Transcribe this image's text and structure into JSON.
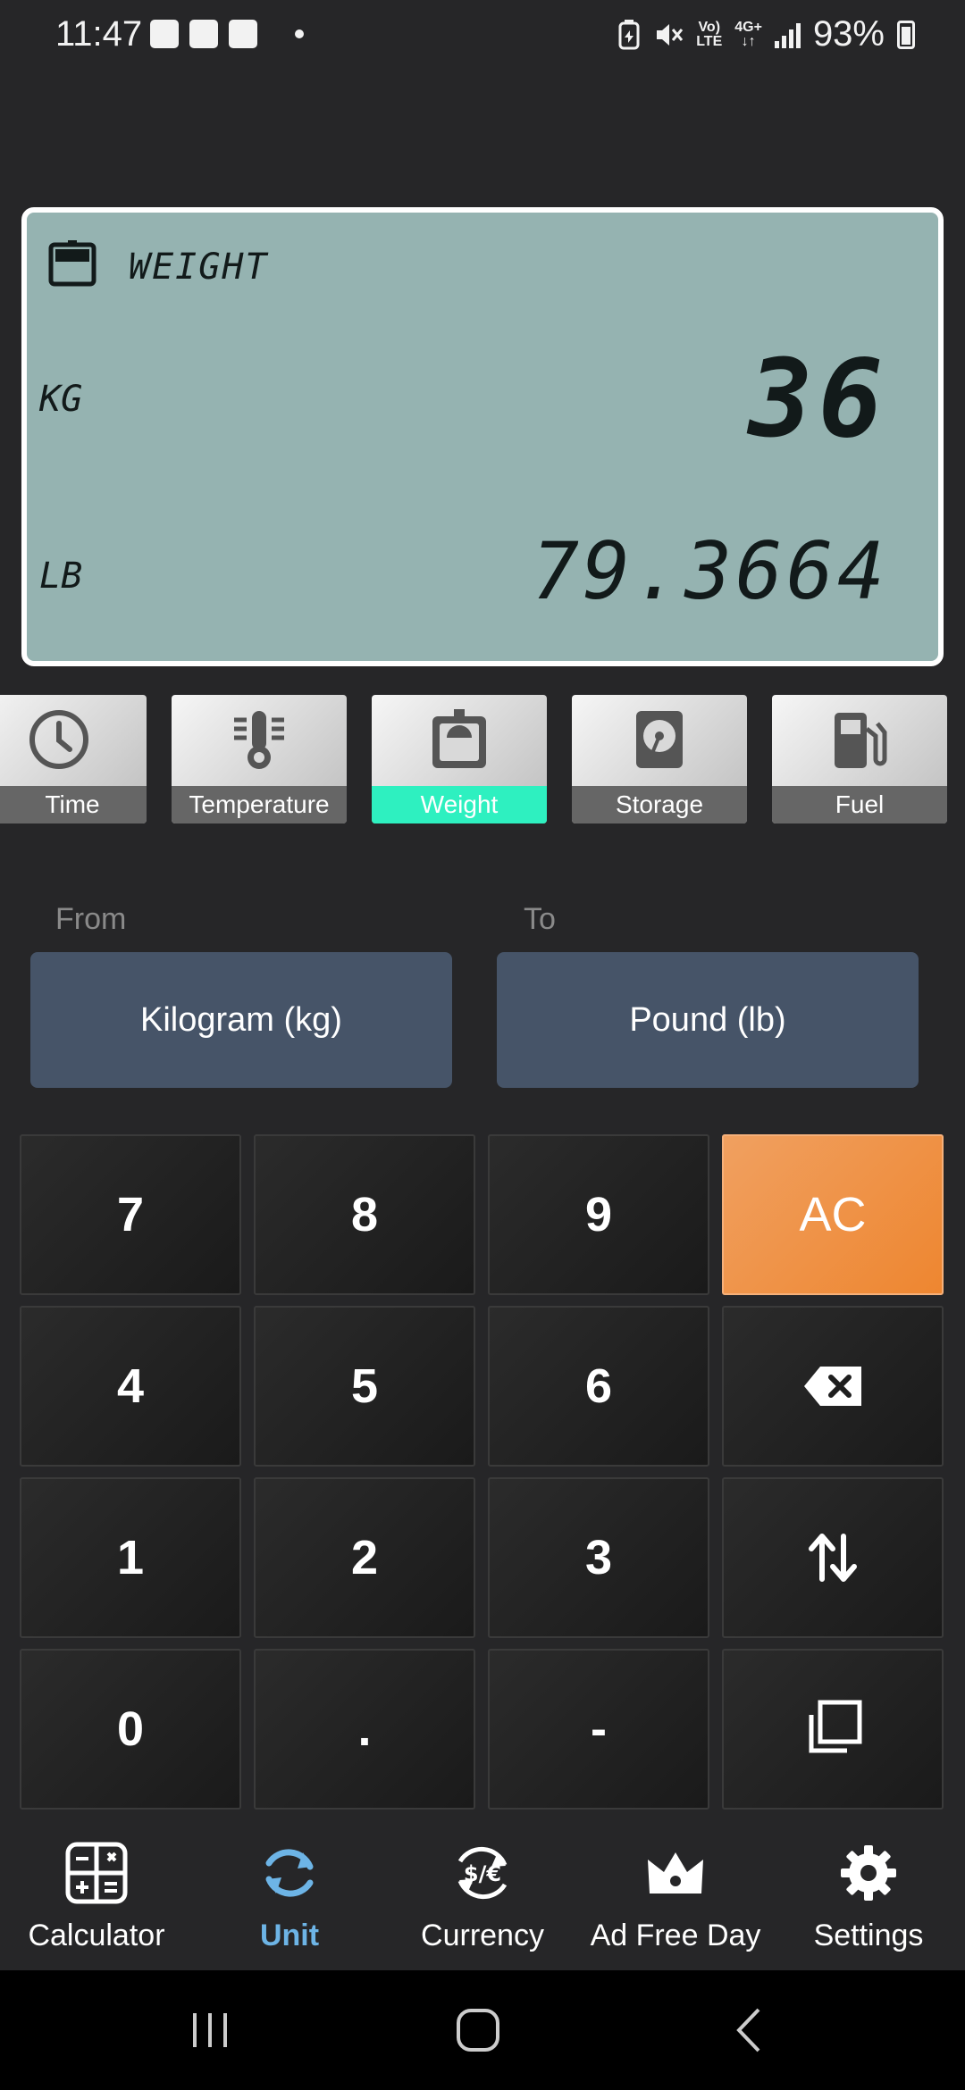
{
  "status_bar": {
    "time": "11:47",
    "battery": "93%",
    "network_top": "Vo)",
    "network_bottom": "LTE",
    "signal_type": "4G+",
    "signal_arrows": "↓↑"
  },
  "display": {
    "category_title": "WEIGHT",
    "category_icon": "weight-scale-icon",
    "input_unit": "KG",
    "input_value": "36",
    "output_unit": "LB",
    "output_value": "79.3664",
    "background_color": "#95b3b1"
  },
  "categories": [
    {
      "label": "Time",
      "icon": "clock-icon"
    },
    {
      "label": "Temperature",
      "icon": "thermometer-icon"
    },
    {
      "label": "Weight",
      "icon": "weight-scale-icon",
      "active": true
    },
    {
      "label": "Storage",
      "icon": "hard-disk-icon"
    },
    {
      "label": "Fuel",
      "icon": "fuel-pump-icon"
    }
  ],
  "conversion": {
    "from_label": "From",
    "from_unit": "Kilogram (kg)",
    "to_label": "To",
    "to_unit": "Pound (lb)"
  },
  "keypad": {
    "rows": [
      [
        "7",
        "8",
        "9",
        "AC"
      ],
      [
        "4",
        "5",
        "6",
        "backspace-icon"
      ],
      [
        "1",
        "2",
        "3",
        "swap-icon"
      ],
      [
        "0",
        ".",
        "-",
        "copy-icon"
      ]
    ],
    "accent_color": "#ee8630"
  },
  "bottom_nav": [
    {
      "label": "Calculator",
      "icon": "calculator-icon"
    },
    {
      "label": "Unit",
      "icon": "refresh-icon",
      "active": true
    },
    {
      "label": "Currency",
      "icon": "currency-exchange-icon"
    },
    {
      "label": "Ad Free Day",
      "icon": "crown-icon"
    },
    {
      "label": "Settings",
      "icon": "gear-icon"
    }
  ],
  "colors": {
    "active_tab": "#6db4e6",
    "active_category": "#2ef0c0",
    "unit_button": "#465468"
  }
}
